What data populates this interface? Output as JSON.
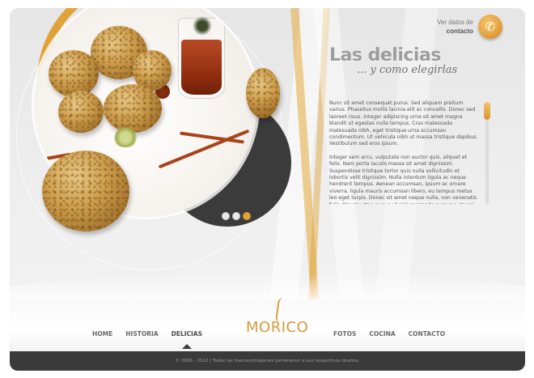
{
  "contact": {
    "line1": "Ver datos de",
    "line2": "contacto",
    "icon": "phone-icon"
  },
  "heading": {
    "title": "Las delicias",
    "subtitle": "... y como elegirlas"
  },
  "article": {
    "paragraphs": [
      "Nunc sit amet consequat purus. Sed aliquam pretium varius. Phasellus mollis lacinia elit ac convallis. Donec sed laoreet risus. Integer adipiscing urna sit amet magna blandit ut egestas nulla tempus. Cras malesuada malesuada nibh, eget tristique urna accumsan condimentum. Ut vehicula nibh ut massa tristique dapibus. Vestibulum sed eros ipsum.",
      "Integer sem arcu, vulputate non auctor quis, aliquet et felis. Nam porta iaculis massa sit amet dignissim. Suspendisse tristique tortor quis nulla sollicitudin et lobortis velit dignissim. Nulla interdum ligula ac neque hendrerit tempus. Aenean accumsan, ipsum ac ornare viverra, ligula mauris accumsan libero, eu tempus metus leo eget turpis. Donec sit amet neque nulla, non venenatis felis. Mauris vitae augue ut nisl commodo cursus a et orci. Quisque a tempus sapien. Aliquam venenatis, lectus nec mattis scelerisque, mi tortor feugiat."
    ]
  },
  "slider": {
    "dots": 3,
    "active_index": 2
  },
  "nav": {
    "left": [
      {
        "label": "HOME",
        "active": false
      },
      {
        "label": "HISTORIA",
        "active": false
      },
      {
        "label": "DELICIAS",
        "active": true
      }
    ],
    "right": [
      {
        "label": "FOTOS",
        "active": false
      },
      {
        "label": "COCINA",
        "active": false
      },
      {
        "label": "CONTACTO",
        "active": false
      }
    ]
  },
  "logo": {
    "text": "MORICO"
  },
  "footer": {
    "text": "© 2006 - 2012 | Todas las marcas/imágenes pertenecen a sus respectivos dueños."
  },
  "colors": {
    "accent": "#e0a33a",
    "dark": "#3a3a3a",
    "text": "#555555"
  }
}
